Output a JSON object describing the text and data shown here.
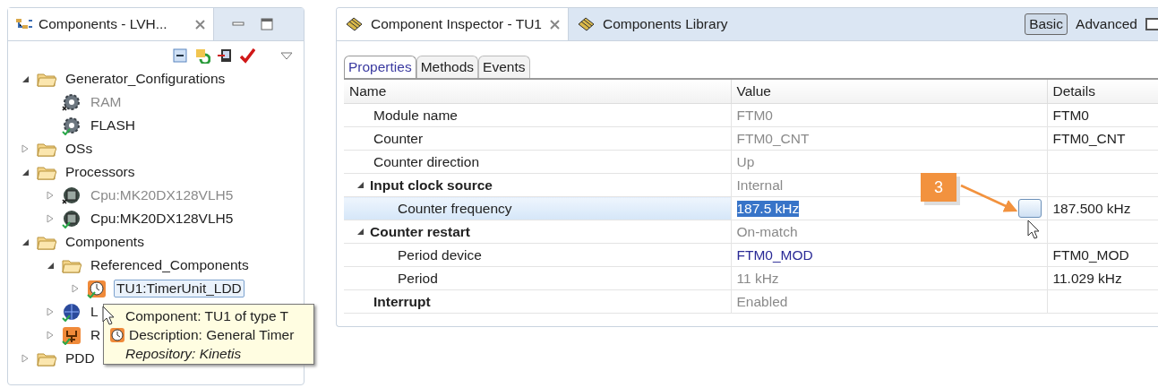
{
  "components_view": {
    "title": "Components - LVH...",
    "tree": [
      {
        "label": "Generator_Configurations",
        "kind": "folder",
        "expanded": true,
        "selected": false,
        "children": [
          {
            "label": "RAM",
            "kind": "config",
            "disabled": true,
            "selected": false
          },
          {
            "label": "FLASH",
            "kind": "config",
            "disabled": false,
            "selected": false
          }
        ]
      },
      {
        "label": "OSs",
        "kind": "folder",
        "expanded": false,
        "selected": false
      },
      {
        "label": "Processors",
        "kind": "folder",
        "expanded": true,
        "selected": false,
        "children": [
          {
            "label": "Cpu:MK20DX128VLH5",
            "kind": "cpu",
            "expanded": false,
            "disabled": true,
            "selected": false
          },
          {
            "label": "Cpu:MK20DX128VLH5",
            "kind": "cpu",
            "expanded": false,
            "disabled": false,
            "selected": false
          }
        ]
      },
      {
        "label": "Components",
        "kind": "folder",
        "expanded": true,
        "selected": false,
        "children": [
          {
            "label": "Referenced_Components",
            "kind": "folder",
            "expanded": true,
            "selected": false,
            "children": [
              {
                "label": "TU1:TimerUnit_LDD",
                "kind": "timer",
                "expanded": false,
                "disabled": false,
                "selected": true
              }
            ]
          },
          {
            "label": "L",
            "kind": "ldd",
            "expanded": false,
            "disabled": false,
            "selected": false
          },
          {
            "label": "R",
            "kind": "bean",
            "expanded": false,
            "disabled": false,
            "selected": false
          }
        ]
      },
      {
        "label": "PDD",
        "kind": "folder",
        "expanded": false,
        "selected": false
      }
    ],
    "tooltip": {
      "component": "Component: TU1 of type T",
      "description": "Description: General Timer",
      "repository": "Repository: Kinetis"
    }
  },
  "inspector": {
    "tabs": [
      {
        "label": "Component Inspector - TU1",
        "selected": true
      },
      {
        "label": "Components Library",
        "selected": false
      }
    ],
    "modes": [
      {
        "label": "Basic",
        "selected": true
      },
      {
        "label": "Advanced",
        "selected": false
      }
    ],
    "subtabs": [
      {
        "label": "Properties",
        "selected": true
      },
      {
        "label": "Methods",
        "selected": false
      },
      {
        "label": "Events",
        "selected": false
      }
    ],
    "columns": [
      "Name",
      "Value",
      "Details"
    ],
    "rows": [
      {
        "name": "Module name",
        "kind": "property",
        "value": "FTM0",
        "readonly": true,
        "link": false,
        "details": "FTM0",
        "selected": false,
        "dialog_button": false
      },
      {
        "name": "Counter",
        "kind": "property",
        "value": "FTM0_CNT",
        "readonly": true,
        "link": false,
        "details": "FTM0_CNT",
        "selected": false,
        "dialog_button": false
      },
      {
        "name": "Counter direction",
        "kind": "property",
        "value": "Up",
        "readonly": true,
        "link": false,
        "selected": false,
        "dialog_button": false
      },
      {
        "name": "Input clock source",
        "kind": "group",
        "expanded": true,
        "value": "Internal",
        "readonly": true,
        "link": false,
        "selected": false,
        "dialog_button": false,
        "children": [
          {
            "name": "Counter frequency",
            "kind": "property",
            "value": "187.5 kHz",
            "readonly": false,
            "link": false,
            "details": "187.500 kHz",
            "selected": true,
            "dialog_button": true
          }
        ]
      },
      {
        "name": "Counter restart",
        "kind": "group",
        "expanded": true,
        "value": "On-match",
        "readonly": true,
        "link": false,
        "selected": false,
        "dialog_button": false,
        "children": [
          {
            "name": "Period device",
            "kind": "property",
            "value": "FTM0_MOD",
            "readonly": false,
            "link": true,
            "details": "FTM0_MOD",
            "selected": false,
            "dialog_button": false
          },
          {
            "name": "Period",
            "kind": "property",
            "value": "11 kHz",
            "readonly": true,
            "link": false,
            "details": "11.029 kHz",
            "selected": false,
            "dialog_button": false
          }
        ]
      },
      {
        "name": "Interrupt",
        "kind": "group",
        "value": "Enabled",
        "readonly": true,
        "link": false,
        "selected": false,
        "dialog_button": false
      }
    ],
    "callout": {
      "label": "3"
    }
  }
}
